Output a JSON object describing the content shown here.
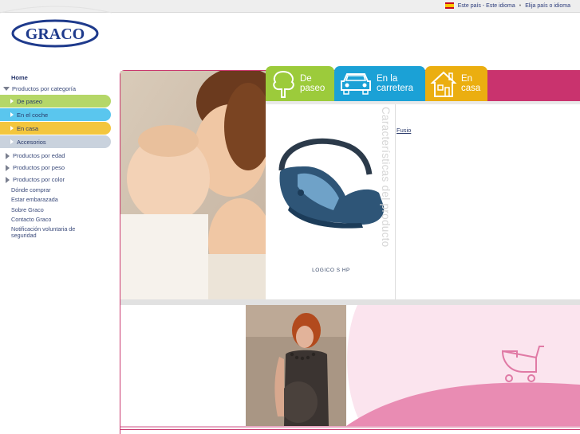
{
  "topbar": {
    "country_text": "Este país - Este idioma",
    "separator": "•",
    "choose_text": "Elija país o idioma"
  },
  "logo": {
    "text": "GRACO"
  },
  "sidebar": {
    "home": "Home",
    "categories_label": "Productos por categoría",
    "categories": [
      {
        "label": "De paseo",
        "color": "#b5d768"
      },
      {
        "label": "En el coche",
        "color": "#5ac6ee"
      },
      {
        "label": "En casa",
        "color": "#f3c63e"
      },
      {
        "label": "Accesorios",
        "color": "#c9d2dd"
      }
    ],
    "groups": [
      "Productos por edad",
      "Productos por peso",
      "Productos por color"
    ],
    "links": [
      "Dónde comprar",
      "Estar embarazada",
      "Sobre Graco",
      "Contacto Graco"
    ],
    "notice": "Notificación voluntaria de seguridad"
  },
  "tabs": [
    {
      "label": "De\npaseo",
      "icon": "tree-icon",
      "color": "#9ccb3b"
    },
    {
      "label": "En la\ncarretera",
      "icon": "car-icon",
      "color": "#1ba1d6"
    },
    {
      "label": "En\ncasa",
      "icon": "house-icon",
      "color": "#ebae10"
    }
  ],
  "product": {
    "name": "LOGICO S HP",
    "section_title": "Características del producto",
    "link": "Fusio"
  },
  "colors": {
    "brand_pink": "#c9336e",
    "brand_blue": "#1e3a8c"
  }
}
